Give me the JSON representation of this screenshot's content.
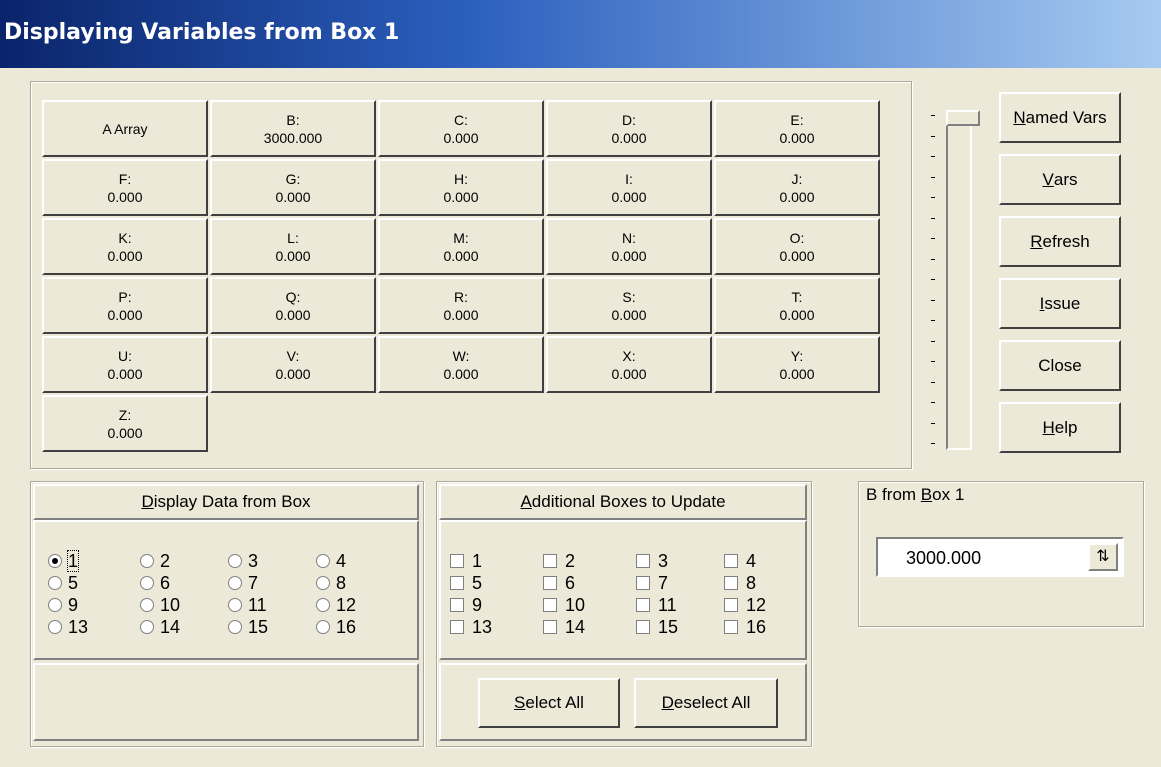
{
  "window": {
    "title": "Displaying Variables from Box 1"
  },
  "variables": [
    {
      "l1": "A Array",
      "l2": ""
    },
    {
      "l1": "B:",
      "l2": "3000.000"
    },
    {
      "l1": "C:",
      "l2": "0.000"
    },
    {
      "l1": "D:",
      "l2": "0.000"
    },
    {
      "l1": "E:",
      "l2": "0.000"
    },
    {
      "l1": "F:",
      "l2": "0.000"
    },
    {
      "l1": "G:",
      "l2": "0.000"
    },
    {
      "l1": "H:",
      "l2": "0.000"
    },
    {
      "l1": "I:",
      "l2": "0.000"
    },
    {
      "l1": "J:",
      "l2": "0.000"
    },
    {
      "l1": "K:",
      "l2": "0.000"
    },
    {
      "l1": "L:",
      "l2": "0.000"
    },
    {
      "l1": "M:",
      "l2": "0.000"
    },
    {
      "l1": "N:",
      "l2": "0.000"
    },
    {
      "l1": "O:",
      "l2": "0.000"
    },
    {
      "l1": "P:",
      "l2": "0.000"
    },
    {
      "l1": "Q:",
      "l2": "0.000"
    },
    {
      "l1": "R:",
      "l2": "0.000"
    },
    {
      "l1": "S:",
      "l2": "0.000"
    },
    {
      "l1": "T:",
      "l2": "0.000"
    },
    {
      "l1": "U:",
      "l2": "0.000"
    },
    {
      "l1": "V:",
      "l2": "0.000"
    },
    {
      "l1": "W:",
      "l2": "0.000"
    },
    {
      "l1": "X:",
      "l2": "0.000"
    },
    {
      "l1": "Y:",
      "l2": "0.000"
    },
    {
      "l1": "Z:",
      "l2": "0.000"
    }
  ],
  "slider": {
    "position": 0
  },
  "buttons": {
    "named_vars": {
      "mn": "N",
      "rest": "amed Vars"
    },
    "vars": {
      "mn": "V",
      "rest": "ars"
    },
    "refresh": {
      "mn": "R",
      "rest": "efresh"
    },
    "issue": {
      "mn": "I",
      "rest": "ssue"
    },
    "close": {
      "label": "Close"
    },
    "help": {
      "mn": "H",
      "rest": "elp"
    }
  },
  "display_box": {
    "title_mn": "D",
    "title_rest": "isplay Data from Box",
    "options": [
      "1",
      "2",
      "3",
      "4",
      "5",
      "6",
      "7",
      "8",
      "9",
      "10",
      "11",
      "12",
      "13",
      "14",
      "15",
      "16"
    ],
    "selected": "1"
  },
  "additional_boxes": {
    "title_mn": "A",
    "title_rest": "dditional Boxes to Update",
    "options": [
      "1",
      "2",
      "3",
      "4",
      "5",
      "6",
      "7",
      "8",
      "9",
      "10",
      "11",
      "12",
      "13",
      "14",
      "15",
      "16"
    ],
    "select_all": {
      "mn": "S",
      "rest": "elect All"
    },
    "deselect_all": {
      "mn": "D",
      "rest": "eselect All"
    }
  },
  "b_from_box": {
    "title_prefix": "B from ",
    "title_mn": "B",
    "title_rest": "ox 1",
    "value": "3000.000"
  }
}
